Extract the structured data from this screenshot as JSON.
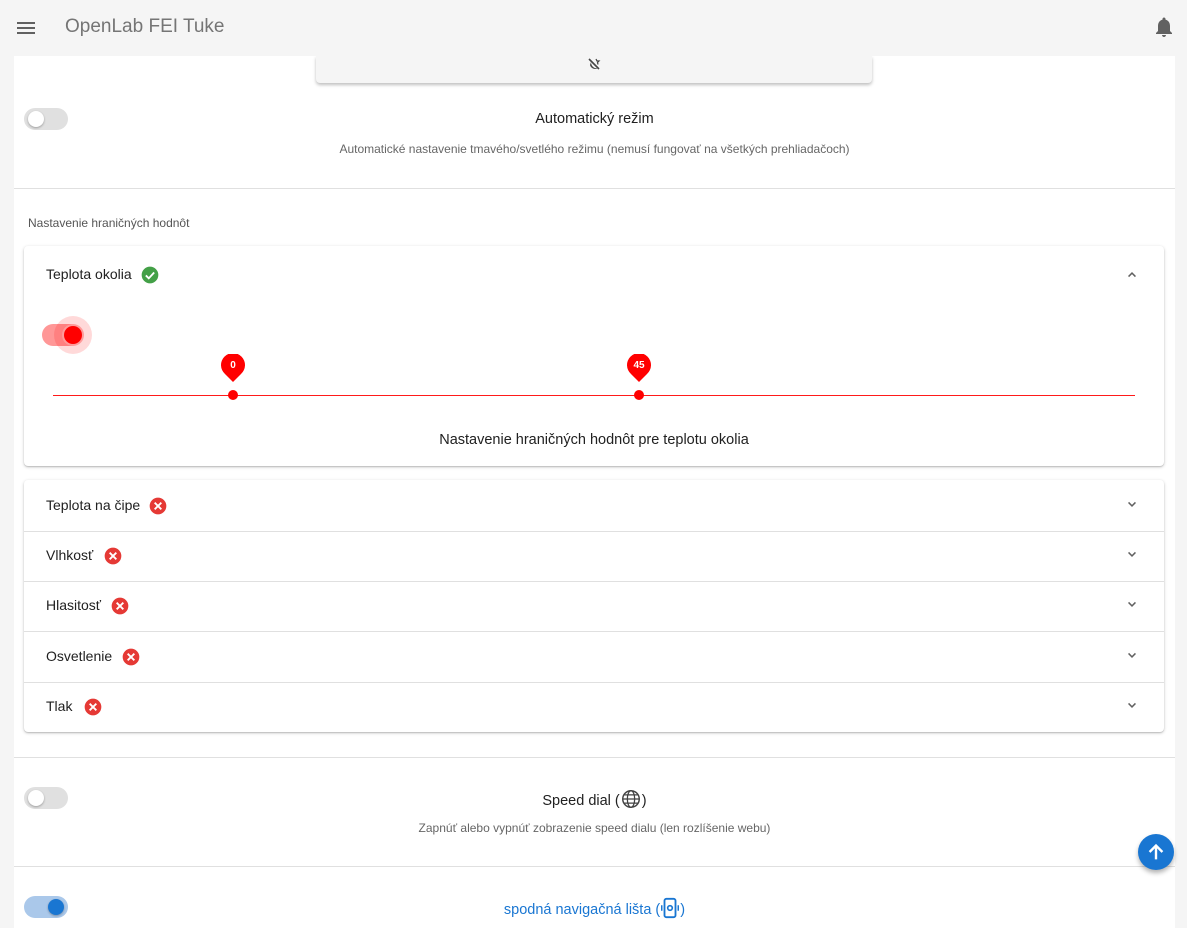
{
  "app": {
    "title": "OpenLab FEI Tuke"
  },
  "auto_mode": {
    "title": "Automatický režim",
    "description": "Automatické nastavenie tmavého/svetlého režimu (nemusí fungovať na všetkých prehliadačoch)",
    "enabled": false
  },
  "thresholds": {
    "section_label": "Nastavenie hraničných hodnôt",
    "expanded": {
      "label": "Teplota okolia",
      "status": "ok",
      "enabled": true,
      "range_low": "0",
      "range_high": "45",
      "caption": "Nastavenie hraničných hodnôt pre teplotu okolia"
    },
    "collapsed": [
      {
        "label": "Teplota na čipe",
        "status": "error"
      },
      {
        "label": "Vlhkosť",
        "status": "error"
      },
      {
        "label": "Hlasitosť",
        "status": "error"
      },
      {
        "label": "Osvetlenie",
        "status": "error"
      },
      {
        "label": "Tlak",
        "status": "error"
      }
    ]
  },
  "speed_dial": {
    "title": "Speed dial (",
    "title_end": ")",
    "description": "Zapnúť alebo vypnúť zobrazenie speed dialu (len rozlíšenie webu)",
    "enabled": false
  },
  "bottom_nav": {
    "title": "spodná navigačná lišta (",
    "title_end": ")",
    "enabled": true
  },
  "colors": {
    "accent": "#1976d2",
    "ok": "#43a047",
    "error": "#e53935",
    "slider": "#ff0000"
  }
}
